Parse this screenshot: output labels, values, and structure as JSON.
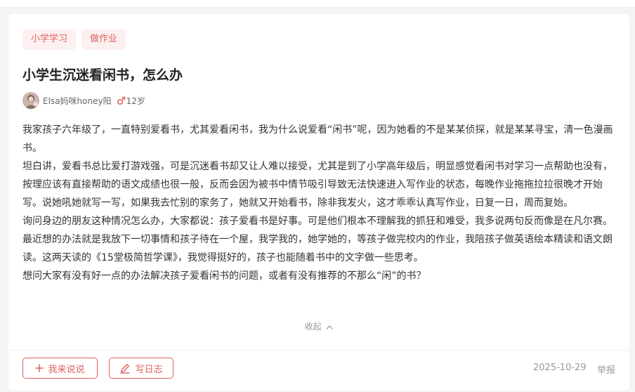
{
  "tags": [
    "小学学习",
    "做作业"
  ],
  "post": {
    "title": "小学生沉迷看闲书，怎么办",
    "author": {
      "name": "Elsa妈咪honey阳",
      "gender_icon": "male-icon",
      "child_age": "12岁"
    },
    "paragraphs": [
      "我家孩子六年级了，一直特别爱看书，尤其爱看闲书，我为什么说爱看“闲书”呢，因为她看的不是某某侦探，就是某某寻宝，清一色漫画书。",
      "坦白讲，爱看书总比爱打游戏强，可是沉迷看书却又让人难以接受，尤其是到了小学高年级后，明显感觉看闲书对学习一点帮助也没有，按理应该有直接帮助的语文成绩也很一般，反而会因为被书中情节吸引导致无法快速进入写作业的状态，每晚作业拖拖拉拉很晚才开始写。说她吼她就写一写，如果我去忙别的家务了，她就又开始看书，除非我发火，这才乖乖认真写作业，日复一日，周而复始。",
      "询问身边的朋友这种情况怎么办，大家都说：孩子爱看书是好事。可是他们根本不理解我的抓狂和难受，我多说两句反而像是在凡尔赛。",
      "最近想的办法就是我放下一切事情和孩子待在一个屋，我学我的，她学她的，等孩子做完校内的作业，我陪孩子做英语绘本精读和语文朗读。这两天读的《15堂极简哲学课》，我觉得挺好的，孩子也能随着书中的文字做一些思考。",
      "想问大家有没有好一点的办法解决孩子爱看闲书的问题，或者有没有推荐的不那么“闲”的书？"
    ],
    "collapse_label": "收起",
    "date": "2025-10-29"
  },
  "actions": {
    "speak_label": "我来说说",
    "diary_label": "写日志",
    "report_label": "举报"
  },
  "colors": {
    "accent": "#e0625f",
    "tag_bg": "#fdf0f0",
    "male": "#e0625f",
    "muted": "#999999"
  }
}
